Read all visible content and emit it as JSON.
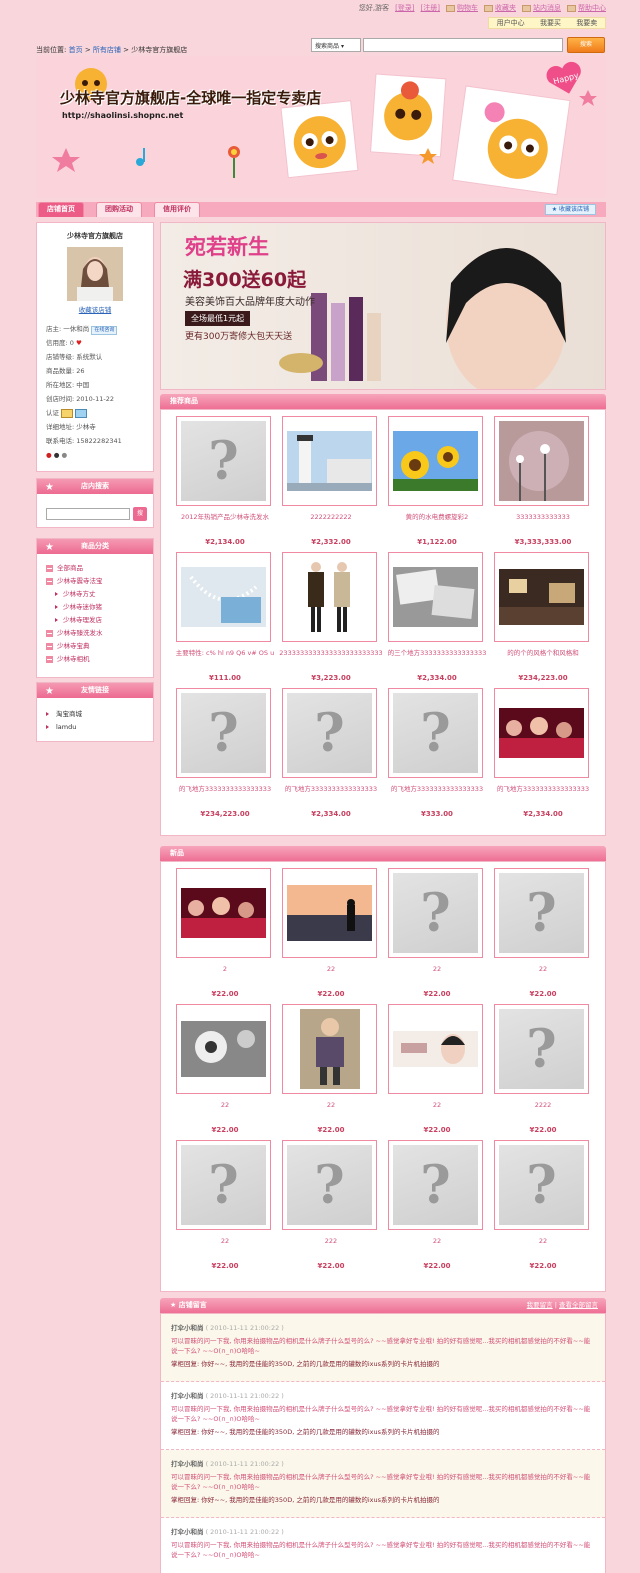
{
  "topbar": {
    "greeting": "您好,游客",
    "login": "[登录]",
    "register": "[注册]",
    "cart": "购物车",
    "favorites": "收藏夹",
    "messages": "站内消息",
    "help": "帮助中心",
    "user_center": "用户中心",
    "buy": "我要买",
    "sell": "我要卖"
  },
  "breadcrumb": {
    "label": "当前位置:",
    "home": "首页",
    "sep1": " > ",
    "all_shops": "所有店铺",
    "sep2": " > ",
    "current": "少林寺官方旗舰店"
  },
  "search": {
    "type": "搜索商品",
    "button": "搜索"
  },
  "banner": {
    "title": "少林寺官方旗舰店-全球唯一指定专卖店",
    "url": "http://shaolinsi.shopnc.net",
    "happy": "Happy"
  },
  "tabs": [
    "店铺首页",
    "团购活动",
    "信用评价"
  ],
  "fav_shop": "收藏该店铺",
  "shop_card": {
    "name": "少林寺官方旗舰店",
    "fav_link": "收藏该店铺",
    "owner": "店主: 一休和尚",
    "owner_badge": "在线咨询",
    "credit": "信用度: 0",
    "level": "店铺等级: 系统默认",
    "count": "商品数量: 26",
    "region": "所在地区: 中国",
    "created": "创店时间: 2010-11-22",
    "auth": "认证",
    "address": "详细地址: 少林寺",
    "phone": "联系电话: 15822282341"
  },
  "shop_search": {
    "title": "店内搜索",
    "button": "搜"
  },
  "categories": {
    "title": "商品分类",
    "items": [
      {
        "label": "全部商品",
        "sub": false
      },
      {
        "label": "少林寺震寺法宝",
        "sub": false
      },
      {
        "label": "少林寺方丈",
        "sub": true
      },
      {
        "label": "少林寺迷你猪",
        "sub": true
      },
      {
        "label": "少林寺理发店",
        "sub": true
      },
      {
        "label": "少林寺臻洗发水",
        "sub": false
      },
      {
        "label": "少林寺宝典",
        "sub": false
      },
      {
        "label": "少林寺相机",
        "sub": false
      }
    ]
  },
  "links": {
    "title": "友情链接",
    "items": [
      "淘宝商城",
      "lamdu"
    ]
  },
  "promo": {
    "title": "宛若新生",
    "line1": "满300送60起",
    "line2": "美容美饰百大品牌年度大动作",
    "line3": "全场最低1元起",
    "line4": "更有300万寄修大包天天送"
  },
  "recommended": {
    "title": "推荐商品",
    "products": [
      {
        "name": "2012年热销产品少林寺洗发水",
        "price": "¥2,134.00",
        "img": "placeholder"
      },
      {
        "name": "2222222222",
        "price": "¥2,332.00",
        "img": "lighthouse"
      },
      {
        "name": "黄的的水电费螺旋彩2",
        "price": "¥1,122.00",
        "img": "sunflower"
      },
      {
        "name": "3333333333333",
        "price": "¥3,333,333.00",
        "img": "flowers"
      },
      {
        "name": "主要特性: c% hl n9 Q6 v# OS u",
        "price": "¥111.00",
        "img": "pearls"
      },
      {
        "name": "2333333333333333333333333",
        "price": "¥3,223.00",
        "img": "fashion"
      },
      {
        "name": "的三个地方3333333333333333",
        "price": "¥2,334.00",
        "img": "photos"
      },
      {
        "name": "的的个的风格个和风格和",
        "price": "¥234,223.00",
        "img": "room"
      },
      {
        "name": "的飞地方3333333333333333",
        "price": "¥234,223.00",
        "img": "placeholder"
      },
      {
        "name": "的飞地方3333333333333333",
        "price": "¥2,334.00",
        "img": "placeholder"
      },
      {
        "name": "的飞地方3333333333333333",
        "price": "¥333.00",
        "img": "placeholder"
      },
      {
        "name": "的飞地方3333333333333333",
        "price": "¥2,334.00",
        "img": "party"
      }
    ]
  },
  "new_products": {
    "title": "新品",
    "products": [
      {
        "name": "2",
        "price": "¥22.00",
        "img": "party"
      },
      {
        "name": "22",
        "price": "¥22.00",
        "img": "sunset"
      },
      {
        "name": "22",
        "price": "¥22.00",
        "img": "placeholder"
      },
      {
        "name": "22",
        "price": "¥22.00",
        "img": "placeholder"
      },
      {
        "name": "22",
        "price": "¥22.00",
        "img": "bwflower"
      },
      {
        "name": "22",
        "price": "¥22.00",
        "img": "child"
      },
      {
        "name": "22",
        "price": "¥22.00",
        "img": "cosmetic"
      },
      {
        "name": "2222",
        "price": "¥22.00",
        "img": "placeholder"
      },
      {
        "name": "22",
        "price": "¥22.00",
        "img": "placeholder"
      },
      {
        "name": "222",
        "price": "¥22.00",
        "img": "placeholder"
      },
      {
        "name": "22",
        "price": "¥22.00",
        "img": "placeholder"
      },
      {
        "name": "22",
        "price": "¥22.00",
        "img": "placeholder"
      }
    ]
  },
  "guestbook": {
    "title": "店铺留言",
    "link1": "我要留言",
    "link2": "查看全部留言",
    "messages": [
      {
        "user": "打伞小和尚",
        "time": "( 2010-11-11 21:00:22 )",
        "q": "可以冒昧的问一下我, 你用来拍摄物品的相机是什么牌子什么型号的么? ~~感觉拿好专业哦! 拍的好有感觉呢...我买的相机都感觉拍的不好看~~能说一下么? ~~O(∩_∩)O哈哈~",
        "a": "掌柜回复: 你好~~, 我用的是佳能的350D, 之前的几款是用的罐数的ixus系列的卡片机拍摄的"
      },
      {
        "user": "打伞小和尚",
        "time": "( 2010-11-11 21:00:22 )",
        "q": "可以冒昧的问一下我, 你用来拍摄物品的相机是什么牌子什么型号的么? ~~感觉拿好专业哦! 拍的好有感觉呢...我买的相机都感觉拍的不好看~~能说一下么? ~~O(∩_∩)O哈哈~",
        "a": "掌柜回复: 你好~~, 我用的是佳能的350D, 之前的几款是用的罐数的ixus系列的卡片机拍摄的"
      },
      {
        "user": "打伞小和尚",
        "time": "( 2010-11-11 21:00:22 )",
        "q": "可以冒昧的问一下我, 你用来拍摄物品的相机是什么牌子什么型号的么? ~~感觉拿好专业哦! 拍的好有感觉呢...我买的相机都感觉拍的不好看~~能说一下么? ~~O(∩_∩)O哈哈~",
        "a": "掌柜回复: 你好~~, 我用的是佳能的350D, 之前的几款是用的罐数的ixus系列的卡片机拍摄的"
      },
      {
        "user": "打伞小和尚",
        "time": "( 2010-11-11 21:00:22 )",
        "q": "可以冒昧的问一下我, 你用来拍摄物品的相机是什么牌子什么型号的么? ~~感觉拿好专业哦! 拍的好有感觉呢...我买的相机都感觉拍的不好看~~能说一下么? ~~O(∩_∩)O哈哈~",
        "a": ""
      }
    ]
  }
}
